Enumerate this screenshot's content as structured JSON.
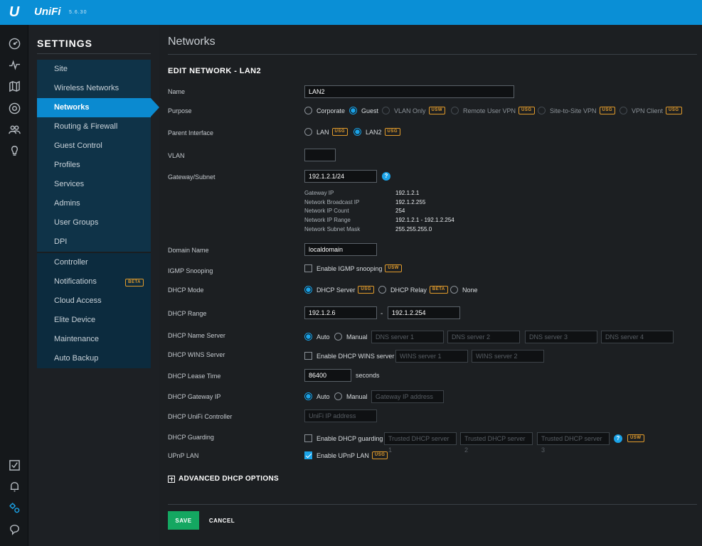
{
  "app": {
    "brand": "UniFi",
    "logo": "U",
    "version": "5.6.30",
    "accent": "#0a8fd6"
  },
  "rail": {
    "top_icons": [
      "dashboard-icon",
      "statistics-icon",
      "map-icon",
      "devices-icon",
      "clients-icon",
      "insights-icon"
    ],
    "bottom_icons": [
      "events-icon",
      "alerts-icon",
      "settings-icon",
      "support-icon"
    ]
  },
  "settings": {
    "title": "SETTINGS",
    "items": [
      {
        "label": "Site"
      },
      {
        "label": "Wireless Networks"
      },
      {
        "label": "Networks"
      },
      {
        "label": "Routing & Firewall"
      },
      {
        "label": "Guest Control"
      },
      {
        "label": "Profiles"
      },
      {
        "label": "Services"
      },
      {
        "label": "Admins"
      },
      {
        "label": "User Groups"
      },
      {
        "label": "DPI"
      }
    ],
    "items2": [
      {
        "label": "Controller"
      },
      {
        "label": "Notifications",
        "badge": "BETA"
      },
      {
        "label": "Cloud Access"
      },
      {
        "label": "Elite Device"
      },
      {
        "label": "Maintenance"
      },
      {
        "label": "Auto Backup"
      }
    ]
  },
  "page": {
    "title": "Networks",
    "section": "EDIT NETWORK - LAN2"
  },
  "form": {
    "name": {
      "label": "Name",
      "value": "LAN2"
    },
    "purpose": {
      "label": "Purpose",
      "options": [
        {
          "label": "Corporate"
        },
        {
          "label": "Guest"
        },
        {
          "label": "VLAN Only",
          "badge": "USW"
        },
        {
          "label": "Remote User VPN",
          "badge": "USG"
        },
        {
          "label": "Site-to-Site VPN",
          "badge": "USG"
        },
        {
          "label": "VPN Client",
          "badge": "USG"
        }
      ]
    },
    "parent": {
      "label": "Parent Interface",
      "options": [
        {
          "label": "LAN",
          "badge": "USG"
        },
        {
          "label": "LAN2",
          "badge": "USG"
        }
      ]
    },
    "vlan": {
      "label": "VLAN",
      "value": ""
    },
    "gateway": {
      "label": "Gateway/Subnet",
      "value": "192.1.2.1/24",
      "help": "?"
    },
    "info": [
      {
        "k": "Gateway IP",
        "v": "192.1.2.1"
      },
      {
        "k": "Network Broadcast IP",
        "v": "192.1.2.255"
      },
      {
        "k": "Network IP Count",
        "v": "254"
      },
      {
        "k": "Network IP Range",
        "v": "192.1.2.1 - 192.1.2.254"
      },
      {
        "k": "Network Subnet Mask",
        "v": "255.255.255.0"
      }
    ],
    "domain": {
      "label": "Domain Name",
      "value": "localdomain"
    },
    "igmp": {
      "label": "IGMP Snooping",
      "option": "Enable IGMP snooping",
      "badge": "USW"
    },
    "dhcp_mode": {
      "label": "DHCP Mode",
      "options": [
        {
          "label": "DHCP Server",
          "badge": "USG"
        },
        {
          "label": "DHCP Relay",
          "badge": "BETA"
        },
        {
          "label": "None"
        }
      ]
    },
    "dhcp_range": {
      "label": "DHCP Range",
      "start": "192.1.2.6",
      "sep": "-",
      "end": "192.1.2.254"
    },
    "name_server": {
      "label": "DHCP Name Server",
      "auto": "Auto",
      "manual": "Manual",
      "placeholders": [
        "DNS server 1",
        "DNS server 2",
        "DNS server 3",
        "DNS server 4"
      ]
    },
    "wins": {
      "label": "DHCP WINS Server",
      "option": "Enable DHCP WINS server",
      "placeholders": [
        "WINS server 1",
        "WINS server 2"
      ]
    },
    "lease": {
      "label": "DHCP Lease Time",
      "value": "86400",
      "unit": "seconds"
    },
    "gw_ip": {
      "label": "DHCP Gateway IP",
      "auto": "Auto",
      "manual": "Manual",
      "placeholder": "Gateway IP address"
    },
    "controller": {
      "label": "DHCP UniFi Controller",
      "placeholder": "UniFi IP address"
    },
    "guarding": {
      "label": "DHCP Guarding",
      "option": "Enable DHCP guarding",
      "placeholders": [
        "Trusted DHCP server 1",
        "Trusted DHCP server 2",
        "Trusted DHCP server 3"
      ],
      "help": "?",
      "badge": "USW"
    },
    "upnp": {
      "label": "UPnP LAN",
      "option": "Enable UPnP LAN",
      "badge": "USG"
    }
  },
  "advanced": "ADVANCED DHCP OPTIONS",
  "buttons": {
    "save": "SAVE",
    "cancel": "CANCEL"
  }
}
